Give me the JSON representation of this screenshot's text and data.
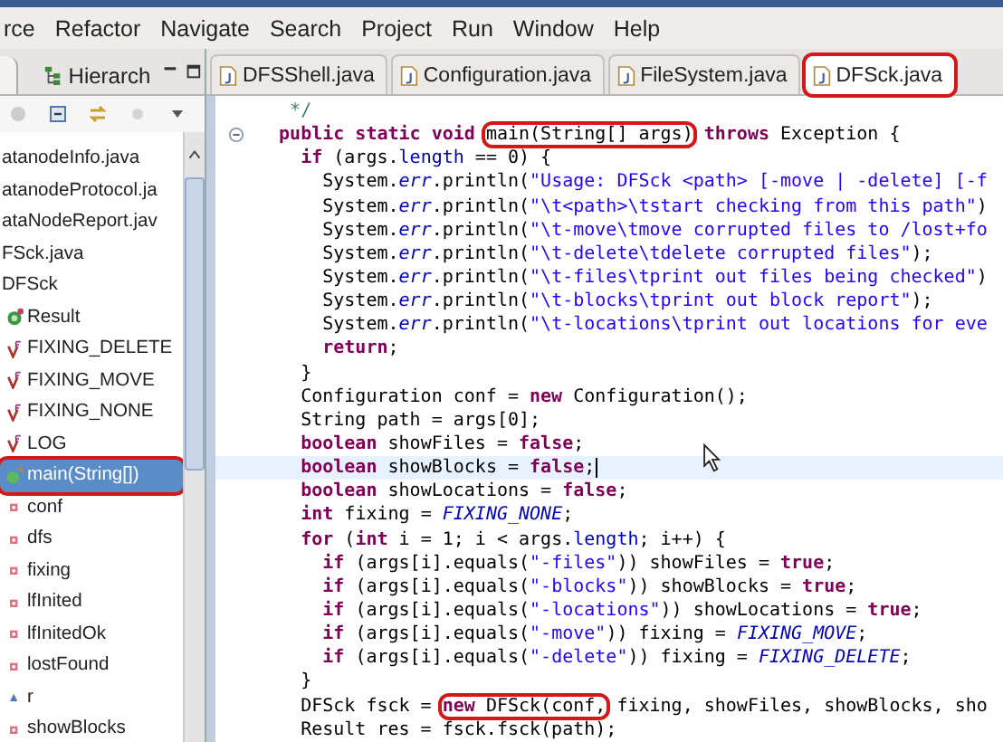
{
  "menu": [
    {
      "label": "rce"
    },
    {
      "label": "Refactor"
    },
    {
      "label": "Navigate"
    },
    {
      "label": "Search"
    },
    {
      "label": "Project"
    },
    {
      "label": "Run"
    },
    {
      "label": "Window"
    },
    {
      "label": "Help"
    }
  ],
  "left_panel": {
    "tabs": [
      {
        "label": "Hierarch",
        "selected": false
      }
    ],
    "tree": [
      {
        "label": "atanodeInfo.java",
        "selected": false,
        "circled": false
      },
      {
        "label": "atanodeProtocol.ja",
        "selected": false,
        "circled": false
      },
      {
        "label": "ataNodeReport.jav",
        "selected": false,
        "circled": false
      },
      {
        "label": "FSck.java",
        "selected": false,
        "circled": false,
        "children": [
          {
            "label": "DFSck",
            "selected": false,
            "circled": false,
            "children": [
              {
                "label": "Result",
                "kind": "class",
                "selected": false,
                "circled": false
              },
              {
                "label": "FIXING_DELETE",
                "kind": "constant",
                "selected": false,
                "circled": false
              },
              {
                "label": "FIXING_MOVE",
                "kind": "constant",
                "selected": false,
                "circled": false
              },
              {
                "label": "FIXING_NONE",
                "kind": "constant",
                "selected": false,
                "circled": false
              },
              {
                "label": "LOG",
                "kind": "constant",
                "selected": false,
                "circled": false
              },
              {
                "label": "main(String[])",
                "kind": "method",
                "selected": true,
                "circled": true
              },
              {
                "label": "conf",
                "kind": "field",
                "selected": false,
                "circled": false
              },
              {
                "label": "dfs",
                "kind": "field",
                "selected": false,
                "circled": false
              },
              {
                "label": "fixing",
                "kind": "field",
                "selected": false,
                "circled": false
              },
              {
                "label": "lfInited",
                "kind": "field",
                "selected": false,
                "circled": false
              },
              {
                "label": "lfInitedOk",
                "kind": "field",
                "selected": false,
                "circled": false
              },
              {
                "label": "lostFound",
                "kind": "field",
                "selected": false,
                "circled": false
              },
              {
                "label": "r",
                "kind": "package-field",
                "selected": false,
                "circled": false
              },
              {
                "label": "showBlocks",
                "kind": "field",
                "selected": false,
                "circled": false
              }
            ]
          }
        ]
      }
    ]
  },
  "editor": {
    "tabs": [
      {
        "label": "DFSShell.java",
        "selected": false,
        "circled": false
      },
      {
        "label": "Configuration.java",
        "selected": false,
        "circled": false
      },
      {
        "label": "FileSystem.java",
        "selected": false,
        "circled": false
      },
      {
        "label": "DFSck.java",
        "selected": true,
        "circled": true
      }
    ],
    "lines": [
      {
        "current": false,
        "fold": false,
        "tokens": [
          {
            "text": "   */",
            "kind": "comment"
          }
        ]
      },
      {
        "current": false,
        "fold": true,
        "tokens": [
          {
            "text": "  public static void",
            "kind": "keyword"
          },
          {
            "text": " main(String[] args)",
            "kind": "plain",
            "circled": true
          },
          {
            "text": " throws",
            "kind": "keyword"
          },
          {
            "text": " Exception {",
            "kind": "plain"
          }
        ]
      },
      {
        "current": false,
        "fold": false,
        "tokens": [
          {
            "text": "    if",
            "kind": "keyword"
          },
          {
            "text": " (args.",
            "kind": "plain"
          },
          {
            "text": "length",
            "kind": "field"
          },
          {
            "text": " == 0) {",
            "kind": "plain"
          }
        ]
      },
      {
        "current": false,
        "fold": false,
        "tokens": [
          {
            "text": "      System.",
            "kind": "plain"
          },
          {
            "text": "err",
            "kind": "static"
          },
          {
            "text": ".println(",
            "kind": "plain"
          },
          {
            "text": "\"Usage: DFSck <path> [-move | -delete] [-f",
            "kind": "string"
          }
        ]
      },
      {
        "current": false,
        "fold": false,
        "tokens": [
          {
            "text": "      System.",
            "kind": "plain"
          },
          {
            "text": "err",
            "kind": "static"
          },
          {
            "text": ".println(",
            "kind": "plain"
          },
          {
            "text": "\"\\t<path>\\tstart checking from this path\"",
            "kind": "string"
          },
          {
            "text": ")",
            "kind": "plain"
          }
        ]
      },
      {
        "current": false,
        "fold": false,
        "tokens": [
          {
            "text": "      System.",
            "kind": "plain"
          },
          {
            "text": "err",
            "kind": "static"
          },
          {
            "text": ".println(",
            "kind": "plain"
          },
          {
            "text": "\"\\t-move\\tmove corrupted files to /lost+fo",
            "kind": "string"
          }
        ]
      },
      {
        "current": false,
        "fold": false,
        "tokens": [
          {
            "text": "      System.",
            "kind": "plain"
          },
          {
            "text": "err",
            "kind": "static"
          },
          {
            "text": ".println(",
            "kind": "plain"
          },
          {
            "text": "\"\\t-delete\\tdelete corrupted files\"",
            "kind": "string"
          },
          {
            "text": ");",
            "kind": "plain"
          }
        ]
      },
      {
        "current": false,
        "fold": false,
        "tokens": [
          {
            "text": "      System.",
            "kind": "plain"
          },
          {
            "text": "err",
            "kind": "static"
          },
          {
            "text": ".println(",
            "kind": "plain"
          },
          {
            "text": "\"\\t-files\\tprint out files being checked\"",
            "kind": "string"
          },
          {
            "text": ")",
            "kind": "plain"
          }
        ]
      },
      {
        "current": false,
        "fold": false,
        "tokens": [
          {
            "text": "      System.",
            "kind": "plain"
          },
          {
            "text": "err",
            "kind": "static"
          },
          {
            "text": ".println(",
            "kind": "plain"
          },
          {
            "text": "\"\\t-blocks\\tprint out block report\"",
            "kind": "string"
          },
          {
            "text": ");",
            "kind": "plain"
          }
        ]
      },
      {
        "current": false,
        "fold": false,
        "tokens": [
          {
            "text": "      System.",
            "kind": "plain"
          },
          {
            "text": "err",
            "kind": "static"
          },
          {
            "text": ".println(",
            "kind": "plain"
          },
          {
            "text": "\"\\t-locations\\tprint out locations for eve",
            "kind": "string"
          }
        ]
      },
      {
        "current": false,
        "fold": false,
        "tokens": [
          {
            "text": "      return",
            "kind": "keyword"
          },
          {
            "text": ";",
            "kind": "plain"
          }
        ]
      },
      {
        "current": false,
        "fold": false,
        "tokens": [
          {
            "text": "    }",
            "kind": "plain"
          }
        ]
      },
      {
        "current": false,
        "fold": false,
        "tokens": [
          {
            "text": "    Configuration conf =",
            "kind": "plain"
          },
          {
            "text": " new",
            "kind": "keyword"
          },
          {
            "text": " Configuration();",
            "kind": "plain"
          }
        ]
      },
      {
        "current": false,
        "fold": false,
        "tokens": [
          {
            "text": "    String path = args[0];",
            "kind": "plain"
          }
        ]
      },
      {
        "current": false,
        "fold": false,
        "tokens": [
          {
            "text": "    boolean",
            "kind": "keyword"
          },
          {
            "text": " showFiles =",
            "kind": "plain"
          },
          {
            "text": " false",
            "kind": "keyword"
          },
          {
            "text": ";",
            "kind": "plain"
          }
        ]
      },
      {
        "current": true,
        "fold": false,
        "tokens": [
          {
            "text": "    boolean",
            "kind": "keyword"
          },
          {
            "text": " showBlocks =",
            "kind": "plain"
          },
          {
            "text": " false",
            "kind": "keyword"
          },
          {
            "text": ";",
            "kind": "plain"
          }
        ]
      },
      {
        "current": false,
        "fold": false,
        "tokens": [
          {
            "text": "    boolean",
            "kind": "keyword"
          },
          {
            "text": " showLocations =",
            "kind": "plain"
          },
          {
            "text": " false",
            "kind": "keyword"
          },
          {
            "text": ";",
            "kind": "plain"
          }
        ]
      },
      {
        "current": false,
        "fold": false,
        "tokens": [
          {
            "text": "    int",
            "kind": "keyword"
          },
          {
            "text": " fixing =",
            "kind": "plain"
          },
          {
            "text": " FIXING_NONE",
            "kind": "static"
          },
          {
            "text": ";",
            "kind": "plain"
          }
        ]
      },
      {
        "current": false,
        "fold": false,
        "tokens": [
          {
            "text": "    for",
            "kind": "keyword"
          },
          {
            "text": " (",
            "kind": "plain"
          },
          {
            "text": "int",
            "kind": "keyword"
          },
          {
            "text": " i = 1; i < args.",
            "kind": "plain"
          },
          {
            "text": "length",
            "kind": "field"
          },
          {
            "text": "; i++) {",
            "kind": "plain"
          }
        ]
      },
      {
        "current": false,
        "fold": false,
        "tokens": [
          {
            "text": "      if",
            "kind": "keyword"
          },
          {
            "text": " (args[i].equals(",
            "kind": "plain"
          },
          {
            "text": "\"-files\"",
            "kind": "string"
          },
          {
            "text": ")) showFiles =",
            "kind": "plain"
          },
          {
            "text": " true",
            "kind": "keyword"
          },
          {
            "text": ";",
            "kind": "plain"
          }
        ]
      },
      {
        "current": false,
        "fold": false,
        "tokens": [
          {
            "text": "      if",
            "kind": "keyword"
          },
          {
            "text": " (args[i].equals(",
            "kind": "plain"
          },
          {
            "text": "\"-blocks\"",
            "kind": "string"
          },
          {
            "text": ")) showBlocks =",
            "kind": "plain"
          },
          {
            "text": " true",
            "kind": "keyword"
          },
          {
            "text": ";",
            "kind": "plain"
          }
        ]
      },
      {
        "current": false,
        "fold": false,
        "tokens": [
          {
            "text": "      if",
            "kind": "keyword"
          },
          {
            "text": " (args[i].equals(",
            "kind": "plain"
          },
          {
            "text": "\"-locations\"",
            "kind": "string"
          },
          {
            "text": ")) showLocations =",
            "kind": "plain"
          },
          {
            "text": " true",
            "kind": "keyword"
          },
          {
            "text": ";",
            "kind": "plain"
          }
        ]
      },
      {
        "current": false,
        "fold": false,
        "tokens": [
          {
            "text": "      if",
            "kind": "keyword"
          },
          {
            "text": " (args[i].equals(",
            "kind": "plain"
          },
          {
            "text": "\"-move\"",
            "kind": "string"
          },
          {
            "text": ")) fixing =",
            "kind": "plain"
          },
          {
            "text": " FIXING_MOVE",
            "kind": "static"
          },
          {
            "text": ";",
            "kind": "plain"
          }
        ]
      },
      {
        "current": false,
        "fold": false,
        "tokens": [
          {
            "text": "      if",
            "kind": "keyword"
          },
          {
            "text": " (args[i].equals(",
            "kind": "plain"
          },
          {
            "text": "\"-delete\"",
            "kind": "string"
          },
          {
            "text": ")) fixing =",
            "kind": "plain"
          },
          {
            "text": " FIXING_DELETE",
            "kind": "static"
          },
          {
            "text": ";",
            "kind": "plain"
          }
        ]
      },
      {
        "current": false,
        "fold": false,
        "tokens": [
          {
            "text": "    }",
            "kind": "plain"
          }
        ]
      },
      {
        "current": false,
        "fold": false,
        "tokens": [
          {
            "text": "    DFSck fsck =",
            "kind": "plain"
          },
          {
            "text": " new",
            "kind": "keyword",
            "circled": true
          },
          {
            "text": " DFSck(conf,",
            "kind": "plain",
            "circled": true
          },
          {
            "text": " fixing, showFiles, showBlocks, sho",
            "kind": "plain"
          }
        ]
      },
      {
        "current": false,
        "fold": false,
        "tokens": [
          {
            "text": "    Result res = fsck.fsck(path);",
            "kind": "plain"
          }
        ]
      }
    ]
  }
}
